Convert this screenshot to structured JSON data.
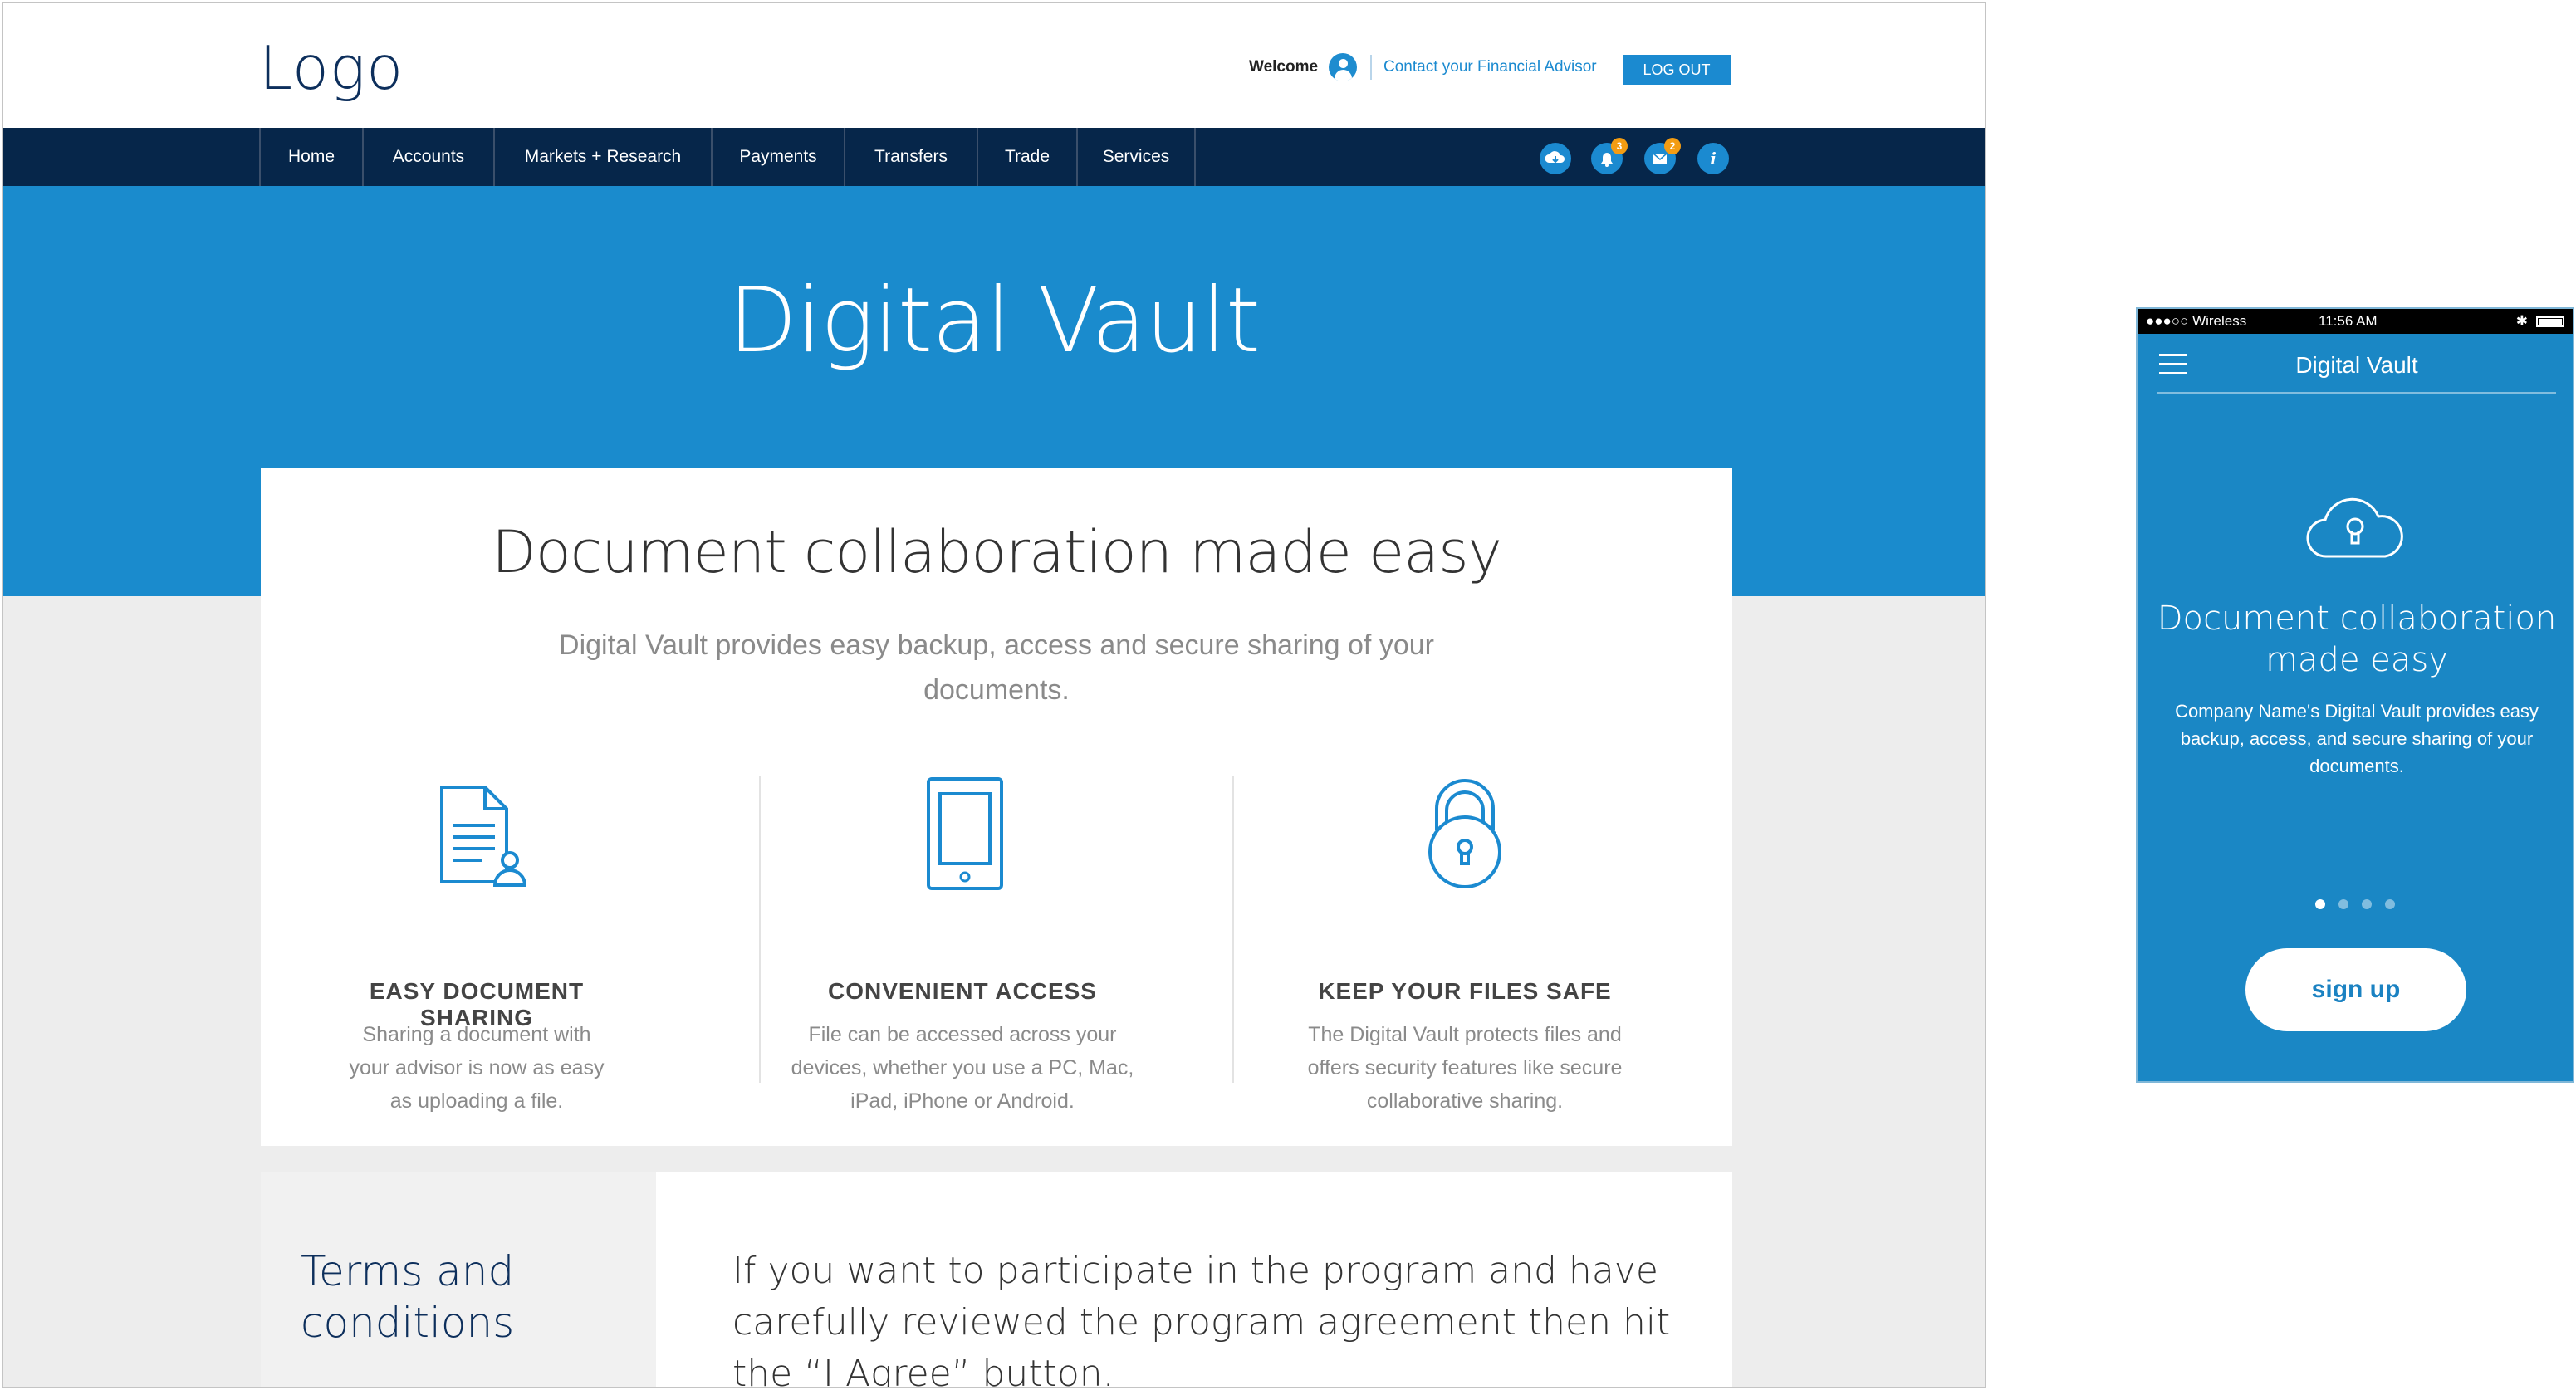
{
  "header": {
    "logo": "Logo",
    "welcome": "Welcome",
    "contact_advisor": "Contact your Financial Advisor",
    "logout_label": "LOG OUT"
  },
  "nav": {
    "items": [
      "Home",
      "Accounts",
      "Markets + Research",
      "Payments",
      "Transfers",
      "Trade",
      "Services"
    ],
    "icons": [
      {
        "name": "cloud-download-icon",
        "glyph": "",
        "badge": ""
      },
      {
        "name": "bell-icon",
        "glyph": "",
        "badge": "3"
      },
      {
        "name": "mail-icon",
        "glyph": "",
        "badge": "2"
      },
      {
        "name": "info-icon",
        "glyph": "i",
        "badge": ""
      }
    ]
  },
  "hero": {
    "title": "Digital Vault"
  },
  "features": {
    "heading": "Document collaboration made easy",
    "subheading": "Digital Vault provides easy backup, access and secure sharing of your documents.",
    "items": [
      {
        "icon": "document-share-icon",
        "title": "EASY DOCUMENT SHARING",
        "desc": "Sharing a document with your advisor is now as easy as uploading a file."
      },
      {
        "icon": "tablet-icon",
        "title": "CONVENIENT ACCESS",
        "desc": "File can be accessed across your devices, whether you use a PC, Mac, iPad, iPhone or Android."
      },
      {
        "icon": "padlock-icon",
        "title": "KEEP YOUR FILES SAFE",
        "desc": "The Digital Vault protects files and offers security features like secure collaborative sharing."
      }
    ]
  },
  "terms": {
    "title": "Terms and conditions",
    "body": "If you want to participate in the program and have carefully reviewed the program agreement then hit the “I Agree” button."
  },
  "mobile": {
    "carrier": "●●●○○ Wireless",
    "time": "11:56 AM",
    "bluetooth": "✱",
    "title": "Digital Vault",
    "heading": "Document collaboration made easy",
    "description": "Company Name's Digital Vault provides easy backup, access, and secure sharing of your documents.",
    "pager_active": 1,
    "pager_total": 4,
    "signup_label": "sign up"
  },
  "colors": {
    "brand_blue": "#1a8bcd",
    "navy": "#06264a",
    "badge_orange": "#f39c12"
  }
}
